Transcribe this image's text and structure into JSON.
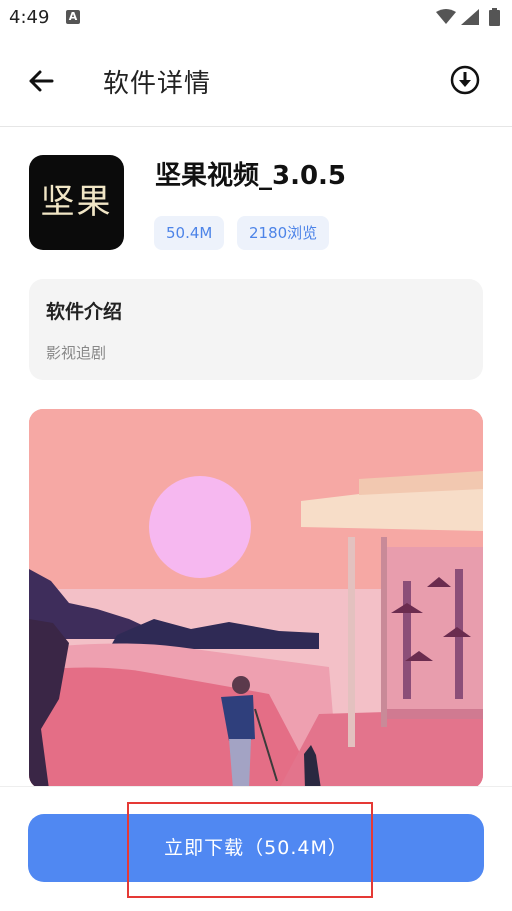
{
  "status_bar": {
    "time": "4:49",
    "notification_icon": "A"
  },
  "app_bar": {
    "title": "软件详情",
    "back_icon": "arrow-left-icon",
    "right_icon": "download-circle-icon"
  },
  "app": {
    "name": "坚果视频_3.0.5",
    "icon_text": "坚果",
    "size": "50.4M",
    "views": "2180浏览"
  },
  "intro": {
    "title": "软件介绍",
    "description": "影视追剧"
  },
  "banner": {
    "description_icon": "illustration-image"
  },
  "download": {
    "label": "立即下载（50.4M）"
  },
  "colors": {
    "accent": "#5088f2",
    "chip_bg": "#edf2fb",
    "chip_text": "#4d84e8",
    "highlight": "#e53935"
  }
}
